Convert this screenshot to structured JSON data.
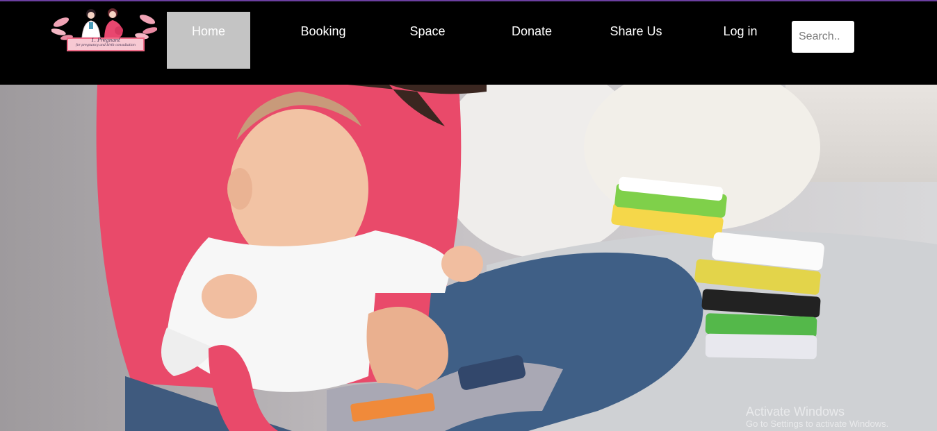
{
  "colors": {
    "header_bg": "#000000",
    "accent_line": "#6b3fa0",
    "nav_active_bg": "#c4c4c4",
    "nav_text": "#ffffff"
  },
  "logo": {
    "line1": "1. Pregnant",
    "line2": "for pregnancy and birth consultation"
  },
  "nav": {
    "items": [
      {
        "label": "Home",
        "active": true
      },
      {
        "label": "Booking"
      },
      {
        "label": "Space"
      },
      {
        "label": "Donate"
      },
      {
        "label": "Share Us"
      },
      {
        "label": "Log in"
      }
    ]
  },
  "search": {
    "placeholder": "Search.."
  },
  "hero": {
    "image": "mother-and-baby-reading-photo"
  },
  "watermark": {
    "title": "Activate Windows",
    "subtitle": "Go to Settings to activate Windows."
  }
}
